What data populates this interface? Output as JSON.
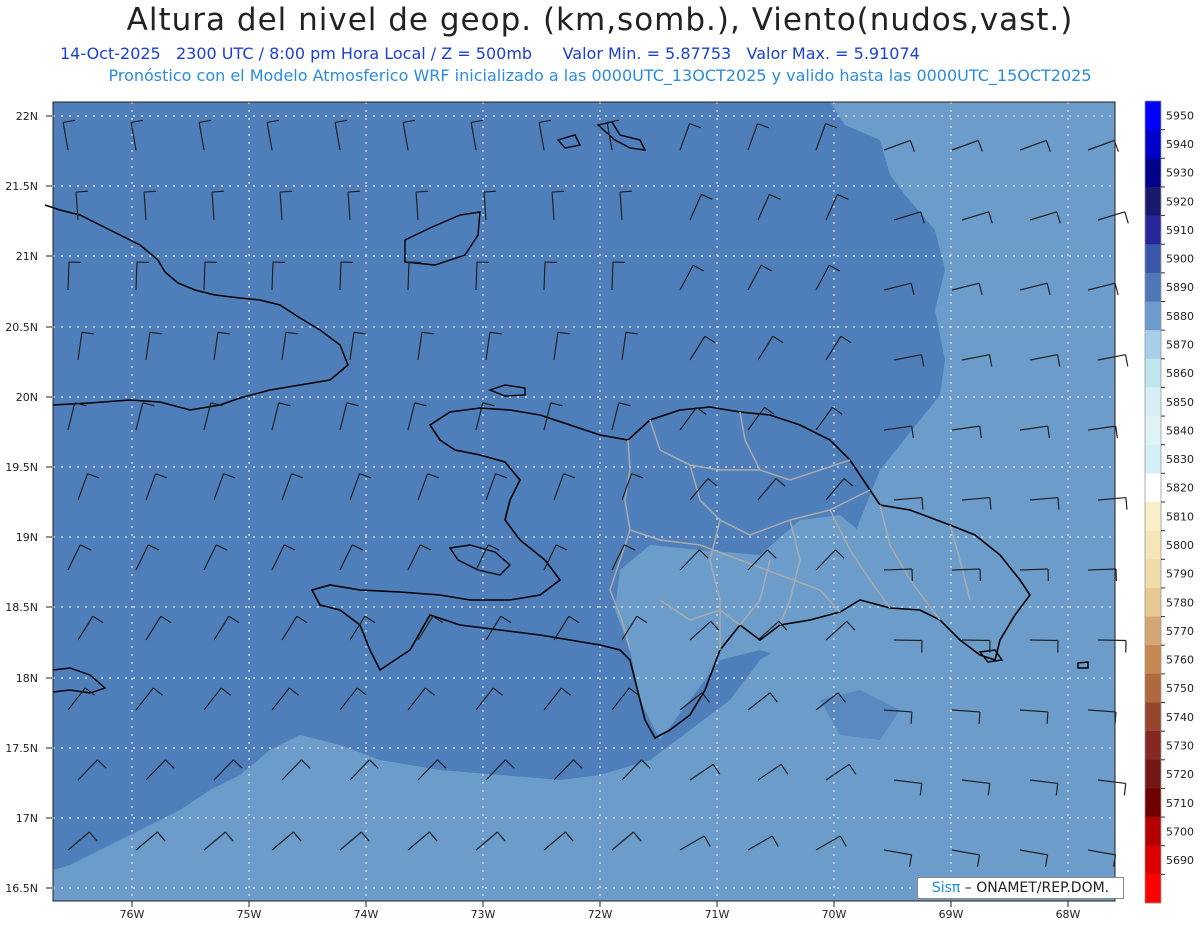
{
  "header": {
    "title": "Altura del nivel de geop. (km,somb.), Viento(nudos,vast.)",
    "date": "14-Oct-2025",
    "time": "2300 UTC / 8:00 pm Hora Local / Z = 500mb",
    "min": "Valor Min. = 5.87753",
    "max": "Valor Max. = 5.91074",
    "model_line": "Pronóstico con el Modelo Atmosferico WRF inicializado a las 0000UTC_13OCT2025 y valido hasta las  0000UTC_15OCT2025"
  },
  "credit": {
    "brand": "Sisπ",
    "rest": " – ONAMET/REP.DOM."
  },
  "map": {
    "lat_labels": [
      "22N",
      "21.5N",
      "21N",
      "20.5N",
      "20N",
      "19.5N",
      "19N",
      "18.5N",
      "18N",
      "17.5N",
      "17N",
      "16.5N"
    ],
    "lon_labels": [
      "76W",
      "75W",
      "74W",
      "73W",
      "72W",
      "71W",
      "70W",
      "69W",
      "68W"
    ],
    "fill_colors": {
      "low": "#6b9cca",
      "high": "#4f7fba",
      "coast": "#000000",
      "borders": "#aaaaaa"
    }
  },
  "colorbar": {
    "levels": [
      "5950",
      "5940",
      "5930",
      "5920",
      "5910",
      "5900",
      "5890",
      "5880",
      "5870",
      "5860",
      "5850",
      "5840",
      "5830",
      "5820",
      "5810",
      "5800",
      "5790",
      "5780",
      "5770",
      "5760",
      "5750",
      "5740",
      "5730",
      "5720",
      "5710",
      "5700",
      "5690"
    ],
    "colors": [
      "#0000ff",
      "#0000cc",
      "#00008b",
      "#191970",
      "#27279a",
      "#3a56a8",
      "#5077b8",
      "#6d9ccc",
      "#a7d0e8",
      "#bfe5ef",
      "#d7eef5",
      "#e0f3f8",
      "#d3eff8",
      "#ffffff",
      "#f8efc8",
      "#f5e6b7",
      "#f0dca9",
      "#e6c890",
      "#d4a673",
      "#c58850",
      "#b0683e",
      "#98452e",
      "#862722",
      "#721616",
      "#700000",
      "#b50000",
      "#dd0000",
      "#ff0000"
    ]
  }
}
